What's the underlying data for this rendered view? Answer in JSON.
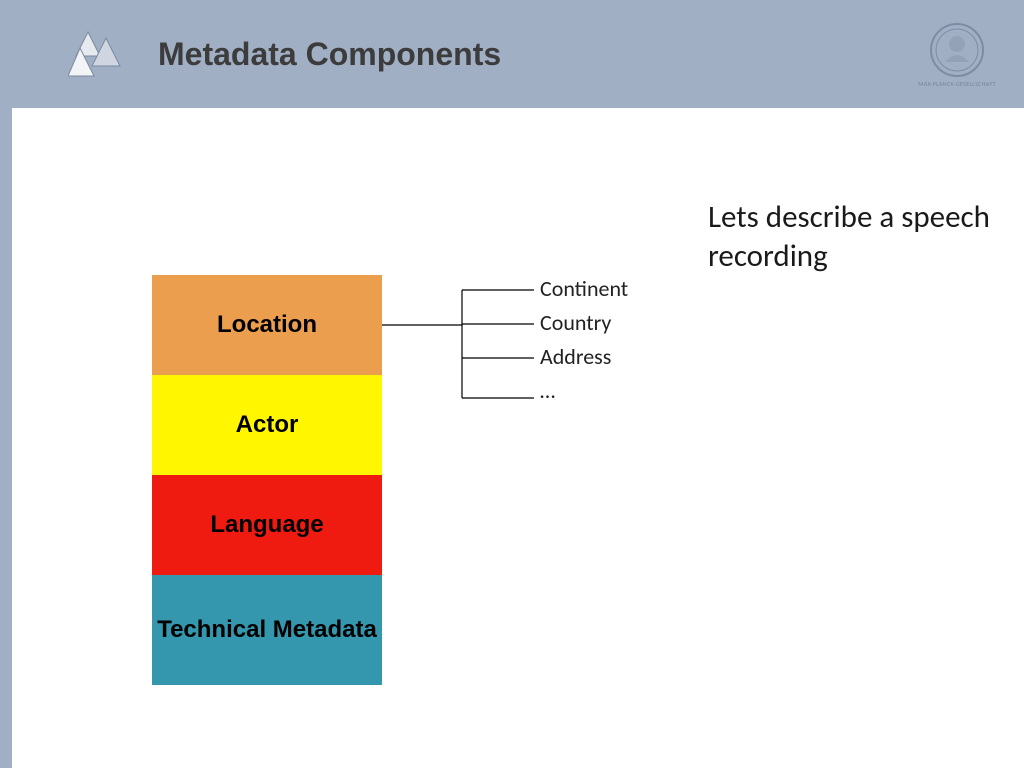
{
  "header": {
    "title": "Metadata Components",
    "seal_text": "MAX-PLANCK-GESELLSCHAFT"
  },
  "blocks": {
    "b0": "Location",
    "b1": "Actor",
    "b2": "Language",
    "b3": "Technical Metadata"
  },
  "branches": {
    "i0": "Continent",
    "i1": "Country",
    "i2": "Address",
    "i3": "…"
  },
  "description": "Lets describe a speech recording"
}
